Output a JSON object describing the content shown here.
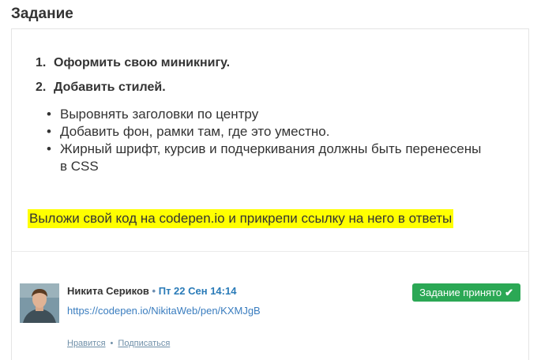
{
  "section": {
    "title": "Задание"
  },
  "task": {
    "ordered": [
      {
        "num": "1.",
        "text": "Оформить свою миникнигу."
      },
      {
        "num": "2.",
        "text": "Добавить стилей."
      }
    ],
    "bullets": [
      "Выровнять заголовки по центру",
      "Добавить фон, рамки там, где это уместно.",
      "Жирный шрифт, курсив и подчеркивания должны быть перенесены в CSS"
    ],
    "highlight": "Выложи свой код на codepen.io и прикрепи ссылку на него в ответы"
  },
  "comment": {
    "author": "Никита Сериков",
    "separator": "•",
    "date": "Пт 22 Сен 14:14",
    "link": "https://codepen.io/NikitaWeb/pen/KXMJgB",
    "status_label": "Задание принято",
    "status_icon": "✔",
    "actions": {
      "like": "Нравится",
      "dot": "•",
      "subscribe": "Подписаться"
    }
  },
  "colors": {
    "highlight": "#ffff00",
    "accepted": "#2ba855",
    "link": "#3a7dbf"
  }
}
